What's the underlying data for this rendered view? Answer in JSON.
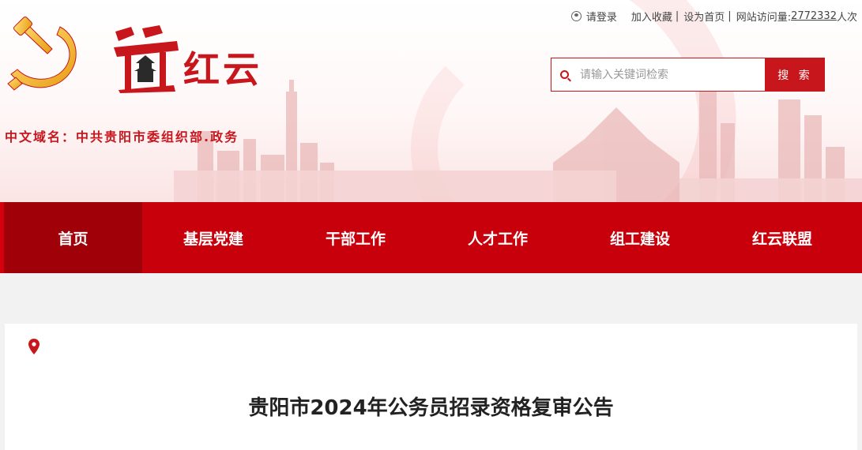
{
  "header": {
    "brand_text": "红云",
    "domain_line": "中文域名：中共贵阳市委组织部.政务",
    "toplinks": {
      "login": "请登录",
      "favorite": "加入收藏",
      "homepage": "设为首页",
      "visits_label": "网站访问量:",
      "visits_count": "2772332",
      "visits_unit": "人次",
      "separator": "|"
    },
    "search": {
      "placeholder": "请输入关键词检索",
      "button": "搜 索"
    },
    "accent_color": "#c8161d"
  },
  "nav": {
    "items": [
      {
        "label": "首页",
        "active": true
      },
      {
        "label": "基层党建"
      },
      {
        "label": "干部工作"
      },
      {
        "label": "人才工作"
      },
      {
        "label": "组工建设"
      },
      {
        "label": "红云联盟"
      }
    ],
    "color": "#c8000b",
    "active_color": "#a00008"
  },
  "main": {
    "location_icon": "map-pin-icon",
    "article_title": "贵阳市2024年公务员招录资格复审公告"
  }
}
